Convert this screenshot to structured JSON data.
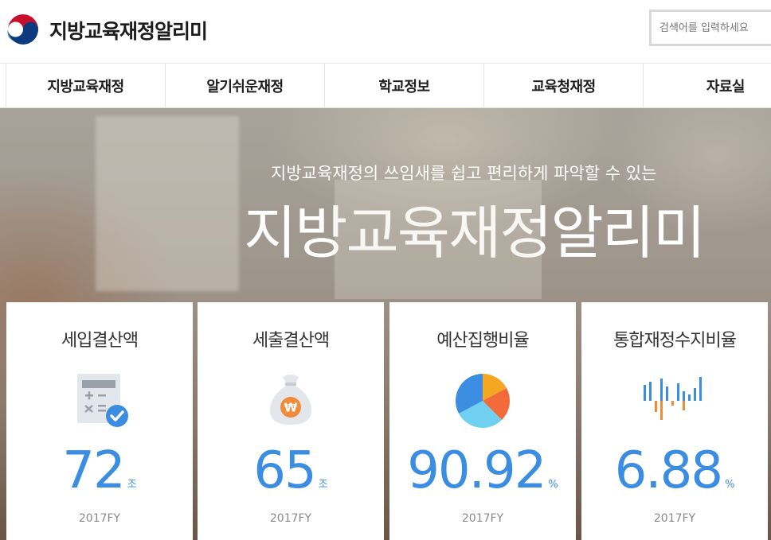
{
  "header": {
    "site_title": "지방교육재정알리미",
    "search_placeholder": "검색어를 입력하세요"
  },
  "nav": {
    "items": [
      {
        "label": "지방교육재정"
      },
      {
        "label": "알기쉬운재정"
      },
      {
        "label": "학교정보"
      },
      {
        "label": "교육청재정"
      },
      {
        "label": "자료실"
      }
    ]
  },
  "hero": {
    "subtitle": "지방교육재정의 쓰임새를 쉽고 편리하게 파악할 수 있는",
    "title": "지방교육재정알리미"
  },
  "cards": [
    {
      "title": "세입결산액",
      "value": "72",
      "unit": "조",
      "year": "2017FY",
      "icon": "calculator-check-icon"
    },
    {
      "title": "세출결산액",
      "value": "65",
      "unit": "조",
      "year": "2017FY",
      "icon": "money-bag-icon"
    },
    {
      "title": "예산집행비율",
      "value": "90.92",
      "unit": "%",
      "year": "2017FY",
      "icon": "pie-chart-icon"
    },
    {
      "title": "통합재정수지비율",
      "value": "6.88",
      "unit": "%",
      "year": "2017FY",
      "icon": "bar-chart-icon"
    }
  ],
  "colors": {
    "accent_blue": "#3b8de2",
    "orange": "#f28a3a",
    "cyan": "#6fd0ef"
  }
}
